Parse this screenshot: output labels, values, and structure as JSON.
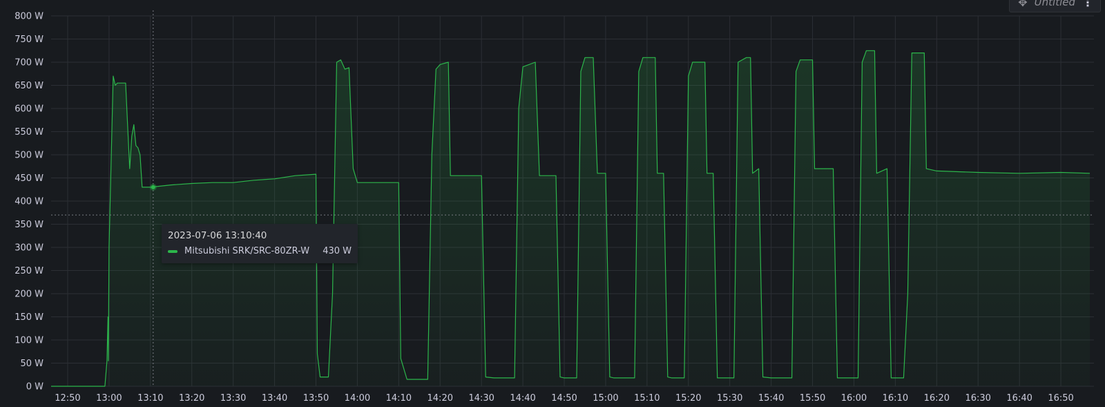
{
  "panel": {
    "title": "Untitled",
    "move_icon": "move-icon",
    "menu_icon": "kebab-menu-icon"
  },
  "tooltip": {
    "time": "2023-07-06 13:10:40",
    "series_name": "Mitsubishi SRK/SRC-80ZR-W",
    "value": "430 W"
  },
  "colors": {
    "background": "#181b1f",
    "series": "#2cb64b",
    "grid": "#2c2f35",
    "text": "#ccccdc"
  },
  "chart_data": {
    "type": "area",
    "title": "Untitled",
    "y_unit": "W",
    "ylim": [
      0,
      800
    ],
    "y_ticks": [
      "0 W",
      "50 W",
      "100 W",
      "150 W",
      "200 W",
      "250 W",
      "300 W",
      "350 W",
      "400 W",
      "450 W",
      "500 W",
      "550 W",
      "600 W",
      "650 W",
      "700 W",
      "750 W",
      "800 W"
    ],
    "x_ticks": [
      "12:50",
      "13:00",
      "13:10",
      "13:20",
      "13:30",
      "13:40",
      "13:50",
      "14:00",
      "14:10",
      "14:20",
      "14:30",
      "14:40",
      "14:50",
      "15:00",
      "15:10",
      "15:20",
      "15:30",
      "15:40",
      "15:50",
      "16:00",
      "16:10",
      "16:20",
      "16:30",
      "16:40",
      "16:50"
    ],
    "x_range": [
      "12:46",
      "16:58"
    ],
    "grid": true,
    "legend": "none",
    "crosshair": {
      "x": "13:10:40",
      "y_value": 370
    },
    "series": [
      {
        "name": "Mitsubishi SRK/SRC-80ZR-W",
        "points": [
          [
            "12:46",
            0
          ],
          [
            "12:59",
            0
          ],
          [
            "12:59:30",
            55
          ],
          [
            "12:59:45",
            150
          ],
          [
            "12:59:50",
            55
          ],
          [
            "13:00",
            300
          ],
          [
            "13:01",
            670
          ],
          [
            "13:01:30",
            650
          ],
          [
            "13:02",
            655
          ],
          [
            "13:04",
            655
          ],
          [
            "13:04:30",
            560
          ],
          [
            "13:05",
            470
          ],
          [
            "13:05:30",
            540
          ],
          [
            "13:06",
            565
          ],
          [
            "13:06:30",
            520
          ],
          [
            "13:07",
            515
          ],
          [
            "13:07:30",
            500
          ],
          [
            "13:08",
            430
          ],
          [
            "13:10",
            430
          ],
          [
            "13:15",
            435
          ],
          [
            "13:20",
            438
          ],
          [
            "13:25",
            440
          ],
          [
            "13:30",
            440
          ],
          [
            "13:35",
            445
          ],
          [
            "13:40",
            448
          ],
          [
            "13:45",
            455
          ],
          [
            "13:50",
            458
          ],
          [
            "13:50:20",
            70
          ],
          [
            "13:51",
            20
          ],
          [
            "13:53",
            20
          ],
          [
            "13:54",
            200
          ],
          [
            "13:55",
            700
          ],
          [
            "13:56",
            705
          ],
          [
            "13:57",
            685
          ],
          [
            "13:58",
            688
          ],
          [
            "13:59",
            470
          ],
          [
            "14:00",
            440
          ],
          [
            "14:05",
            440
          ],
          [
            "14:10",
            440
          ],
          [
            "14:10:30",
            60
          ],
          [
            "14:12",
            15
          ],
          [
            "14:17",
            15
          ],
          [
            "14:18",
            500
          ],
          [
            "14:19",
            685
          ],
          [
            "14:20",
            695
          ],
          [
            "14:22",
            700
          ],
          [
            "14:22:30",
            455
          ],
          [
            "14:25",
            455
          ],
          [
            "14:30",
            455
          ],
          [
            "14:31",
            20
          ],
          [
            "14:33",
            18
          ],
          [
            "14:38",
            18
          ],
          [
            "14:39",
            600
          ],
          [
            "14:40",
            690
          ],
          [
            "14:43",
            700
          ],
          [
            "14:44",
            455
          ],
          [
            "14:48",
            455
          ],
          [
            "14:49",
            20
          ],
          [
            "14:50",
            18
          ],
          [
            "14:53",
            18
          ],
          [
            "14:54",
            680
          ],
          [
            "14:55",
            710
          ],
          [
            "14:57",
            710
          ],
          [
            "14:58",
            460
          ],
          [
            "15:00",
            460
          ],
          [
            "15:01",
            20
          ],
          [
            "15:02",
            18
          ],
          [
            "15:07",
            18
          ],
          [
            "15:08",
            680
          ],
          [
            "15:09",
            710
          ],
          [
            "15:12",
            710
          ],
          [
            "15:12:30",
            460
          ],
          [
            "15:14",
            460
          ],
          [
            "15:15",
            20
          ],
          [
            "15:16",
            18
          ],
          [
            "15:19",
            18
          ],
          [
            "15:20",
            670
          ],
          [
            "15:21",
            700
          ],
          [
            "15:24",
            700
          ],
          [
            "15:24:30",
            460
          ],
          [
            "15:26",
            460
          ],
          [
            "15:27",
            18
          ],
          [
            "15:30",
            18
          ],
          [
            "15:31",
            18
          ],
          [
            "15:32",
            700
          ],
          [
            "15:34",
            710
          ],
          [
            "15:35",
            710
          ],
          [
            "15:35:30",
            460
          ],
          [
            "15:37",
            470
          ],
          [
            "15:38",
            20
          ],
          [
            "15:40",
            18
          ],
          [
            "15:45",
            18
          ],
          [
            "15:46",
            680
          ],
          [
            "15:47",
            705
          ],
          [
            "15:50",
            705
          ],
          [
            "15:50:30",
            470
          ],
          [
            "15:55",
            470
          ],
          [
            "15:56",
            18
          ],
          [
            "15:59",
            18
          ],
          [
            "16:01",
            18
          ],
          [
            "16:02",
            700
          ],
          [
            "16:03",
            725
          ],
          [
            "16:05",
            725
          ],
          [
            "16:05:30",
            460
          ],
          [
            "16:08",
            470
          ],
          [
            "16:09",
            18
          ],
          [
            "16:10",
            18
          ],
          [
            "16:12",
            18
          ],
          [
            "16:13",
            200
          ],
          [
            "16:14",
            720
          ],
          [
            "16:17",
            720
          ],
          [
            "16:17:30",
            470
          ],
          [
            "16:20",
            465
          ],
          [
            "16:30",
            462
          ],
          [
            "16:40",
            460
          ],
          [
            "16:50",
            462
          ],
          [
            "16:57",
            460
          ]
        ]
      }
    ]
  }
}
